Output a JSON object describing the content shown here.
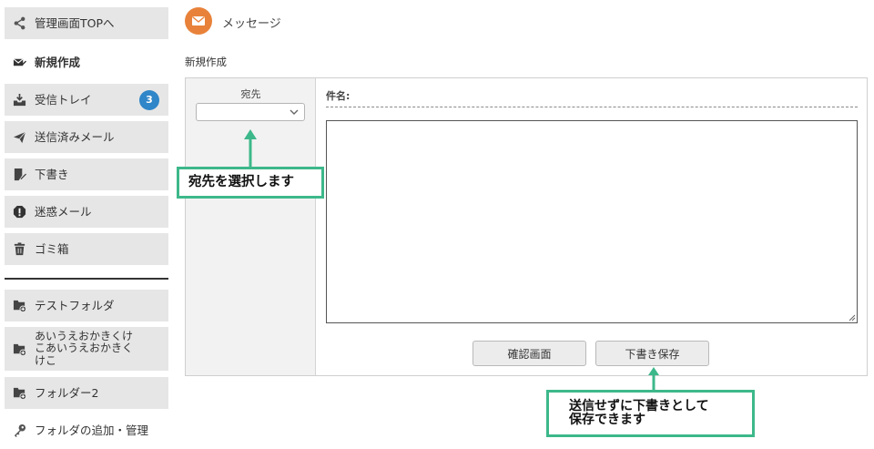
{
  "sidebar": {
    "items": [
      {
        "label": "管理画面TOPへ",
        "icon": "share-icon"
      },
      {
        "label": "新規作成",
        "icon": "compose-mail-icon",
        "active": true
      },
      {
        "label": "受信トレイ",
        "icon": "inbox-icon",
        "badge": "3"
      },
      {
        "label": "送信済みメール",
        "icon": "send-icon"
      },
      {
        "label": "下書き",
        "icon": "draft-icon"
      },
      {
        "label": "迷惑メール",
        "icon": "alert-icon"
      },
      {
        "label": "ゴミ箱",
        "icon": "trash-icon"
      },
      {
        "label": "テストフォルダ",
        "icon": "folder-add-icon"
      },
      {
        "label": "あいうえおかきくけ\nこあいうえおかきく\nけこ",
        "icon": "folder-add-icon"
      },
      {
        "label": "フォルダー2",
        "icon": "folder-add-icon"
      },
      {
        "label": "フォルダの追加・管理",
        "icon": "key-icon"
      }
    ]
  },
  "header": {
    "title": "メッセージ",
    "icon": "message-icon",
    "subtitle": "新規作成"
  },
  "compose": {
    "to_label": "宛先",
    "to_value": "",
    "subject_label": "件名:",
    "body_value": "",
    "confirm_label": "確認画面",
    "save_draft_label": "下書き保存"
  },
  "annotations": {
    "select_recipient": "宛先を選択します",
    "save_draft_line1": "送信せずに下書きとして",
    "save_draft_line2": "保存できます"
  },
  "colors": {
    "accent_orange": "#e8823a",
    "badge_blue": "#2f86c8",
    "annotation_green": "#3db88b",
    "sidebar_bg": "#e6e6e6"
  }
}
